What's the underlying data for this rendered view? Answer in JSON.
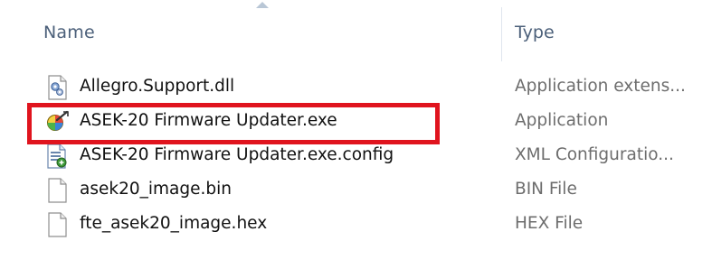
{
  "header": {
    "name_label": "Name",
    "type_label": "Type"
  },
  "files": [
    {
      "name": "Allegro.Support.dll",
      "type": "Application extens...",
      "icon": "dll-file-icon"
    },
    {
      "name": "ASEK-20 Firmware Updater.exe",
      "type": "Application",
      "icon": "application-exe-icon"
    },
    {
      "name": "ASEK-20 Firmware Updater.exe.config",
      "type": "XML Configuratio...",
      "icon": "xml-config-file-icon"
    },
    {
      "name": "asek20_image.bin",
      "type": "BIN File",
      "icon": "blank-file-icon"
    },
    {
      "name": "fte_asek20_image.hex",
      "type": "HEX File",
      "icon": "blank-file-icon"
    }
  ],
  "colors": {
    "highlight": "#e0141e",
    "header_text": "#4c607a",
    "type_text": "#6d6d6d"
  }
}
